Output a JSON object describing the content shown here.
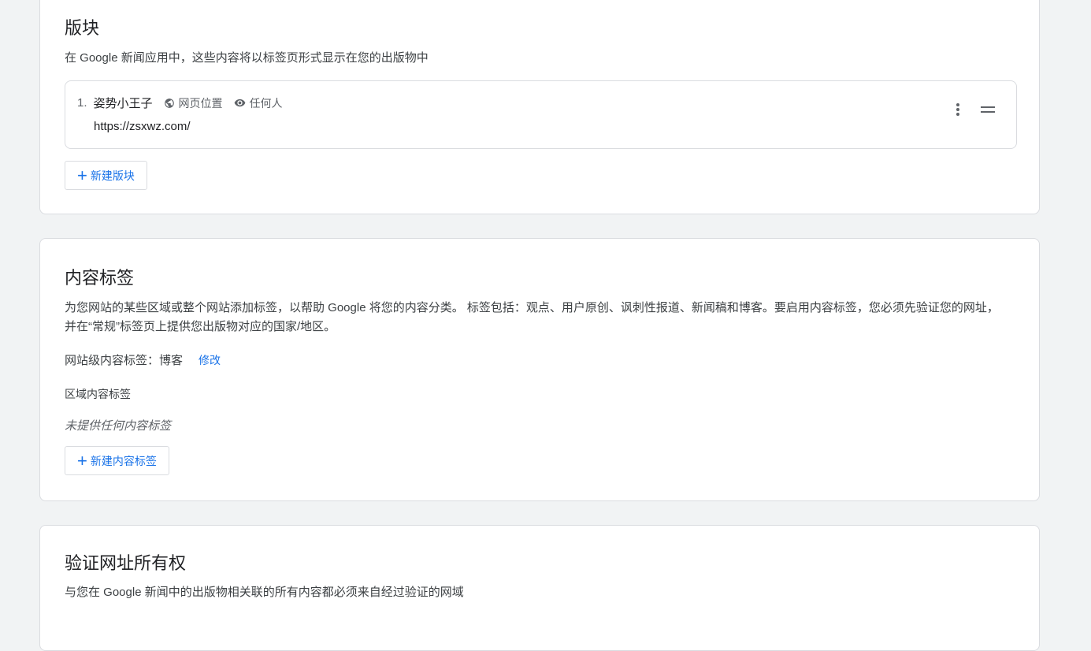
{
  "sections_card": {
    "title": "版块",
    "description": "在 Google 新闻应用中，这些内容将以标签页形式显示在您的出版物中",
    "items": [
      {
        "index": "1.",
        "name": "姿势小王子",
        "location_label": "网页位置",
        "visibility_label": "任何人",
        "url": "https://zsxwz.com/"
      }
    ],
    "new_button_label": "新建版块"
  },
  "labels_card": {
    "title": "内容标签",
    "description": "为您网站的某些区域或整个网站添加标签，以帮助 Google 将您的内容分类。 标签包括：观点、用户原创、讽刺性报道、新闻稿和博客。要启用内容标签，您必须先验证您的网址，并在“常规”标签页上提供您出版物对应的国家/地区。",
    "site_label_text": "网站级内容标签：博客",
    "edit_label": "修改",
    "section_labels_heading": "区域内容标签",
    "empty_note": "未提供任何内容标签",
    "new_button_label": "新建内容标签"
  },
  "verify_card": {
    "title": "验证网址所有权",
    "description": "与您在 Google 新闻中的出版物相关联的所有内容都必须来自经过验证的网域"
  },
  "colors": {
    "accent": "#1a73e8",
    "background": "#f1f3f4",
    "border": "#dadce0"
  }
}
